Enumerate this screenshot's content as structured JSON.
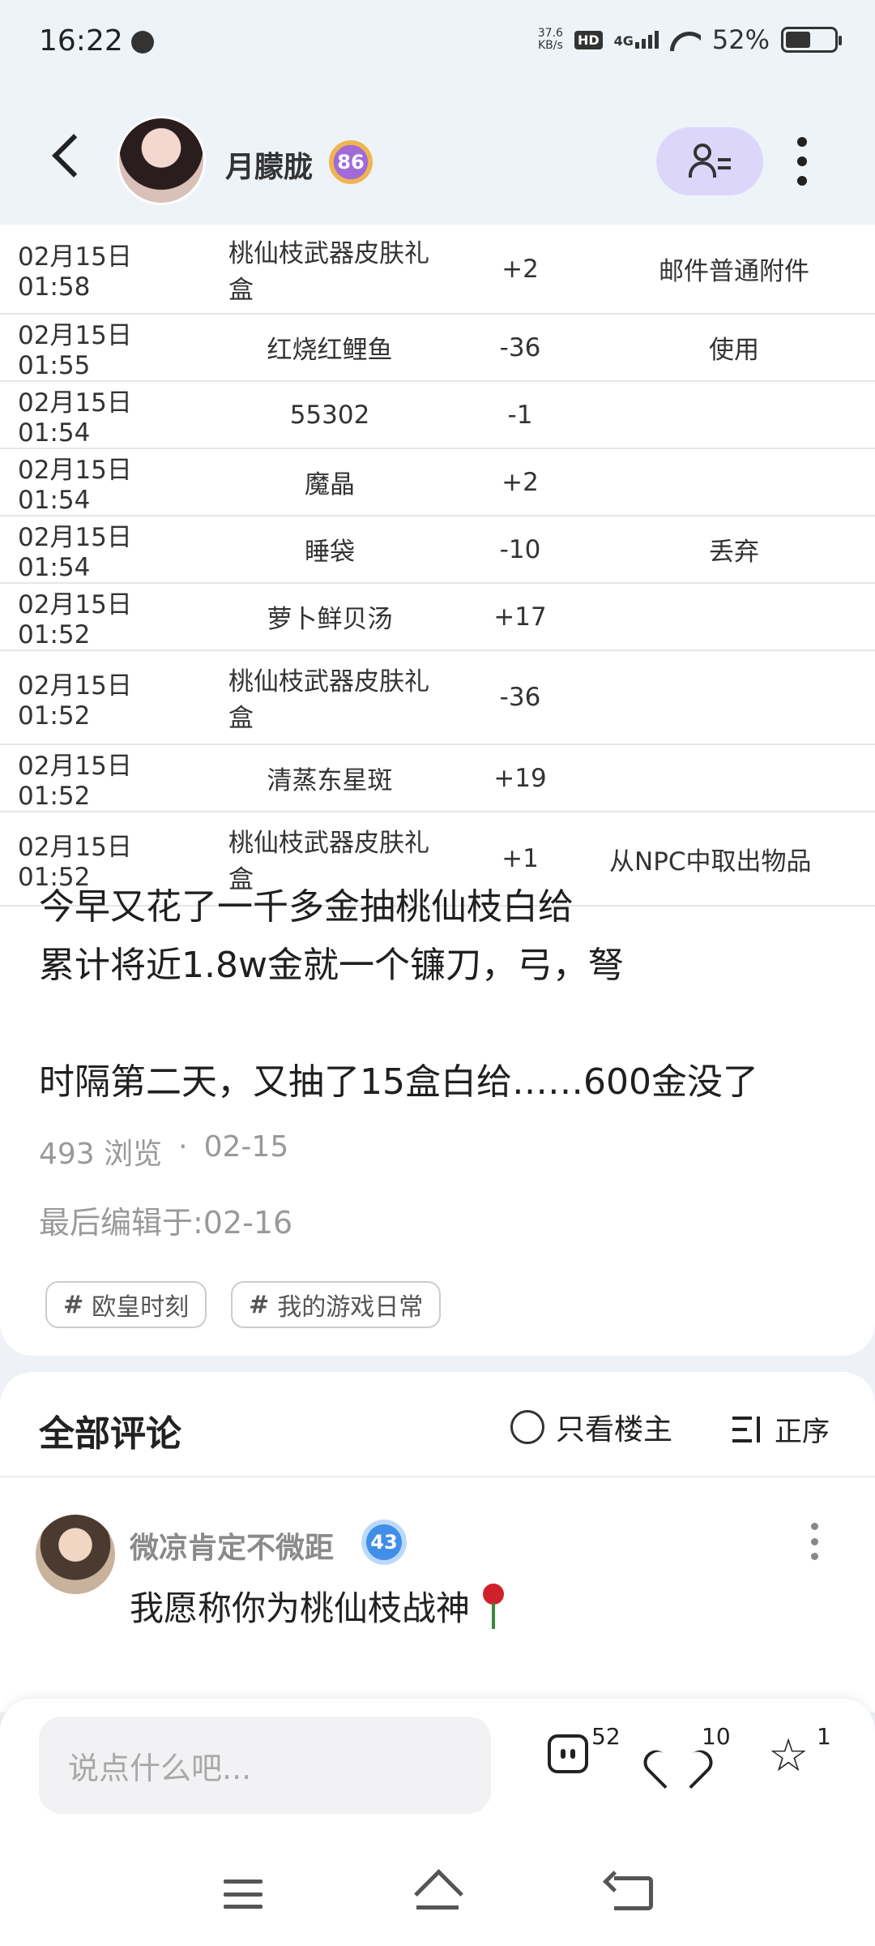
{
  "status_bar": {
    "time": "16:22",
    "net_speed_value": "37.6",
    "net_speed_unit": "KB/s",
    "hd": "HD",
    "network": "4G",
    "battery": "52%"
  },
  "header": {
    "username": "月朦胧",
    "level": "86"
  },
  "log_rows": [
    {
      "time": "02月15日 01:58",
      "item": "桃仙枝武器皮肤礼盒",
      "amount": "+2",
      "source": "邮件普通附件"
    },
    {
      "time": "02月15日 01:55",
      "item": "红烧红鲤鱼",
      "amount": "-36",
      "source": "使用"
    },
    {
      "time": "02月15日 01:54",
      "item": "55302",
      "amount": "-1",
      "source": ""
    },
    {
      "time": "02月15日 01:54",
      "item": "魔晶",
      "amount": "+2",
      "source": ""
    },
    {
      "time": "02月15日 01:54",
      "item": "睡袋",
      "amount": "-10",
      "source": "丢弃"
    },
    {
      "time": "02月15日 01:52",
      "item": "萝卜鲜贝汤",
      "amount": "+17",
      "source": ""
    },
    {
      "time": "02月15日 01:52",
      "item": "桃仙枝武器皮肤礼盒",
      "amount": "-36",
      "source": ""
    },
    {
      "time": "02月15日 01:52",
      "item": "清蒸东星斑",
      "amount": "+19",
      "source": ""
    },
    {
      "time": "02月15日 01:52",
      "item": "桃仙枝武器皮肤礼盒",
      "amount": "+1",
      "source": "从NPC中取出物品"
    }
  ],
  "post": {
    "line1": "今早又花了一千多金抽桃仙枝白给",
    "line2": "累计将近1.8w金就一个镰刀，弓，弩",
    "line3": "时隔第二天，又抽了15盒白给……600金没了",
    "views": "493 浏览",
    "dot": "·",
    "date": "02-15",
    "edited": "最后编辑于:02-16",
    "tags": [
      "欧皇时刻",
      "我的游戏日常"
    ]
  },
  "comments": {
    "title": "全部评论",
    "only_op": "只看楼主",
    "sort": "正序",
    "first": {
      "name": "微凉肯定不微距",
      "level": "43",
      "text": "我愿称你为桃仙枝战神"
    }
  },
  "bottom": {
    "input_placeholder": "说点什么吧...",
    "comments_count": "52",
    "likes_count": "10",
    "favorites_count": "1"
  },
  "icons": {
    "back": "back-arrow-icon",
    "follow": "user-follow-icon",
    "more": "more-vertical-icon",
    "comment": "comment-icon",
    "like": "heart-icon",
    "favorite": "star-icon"
  }
}
